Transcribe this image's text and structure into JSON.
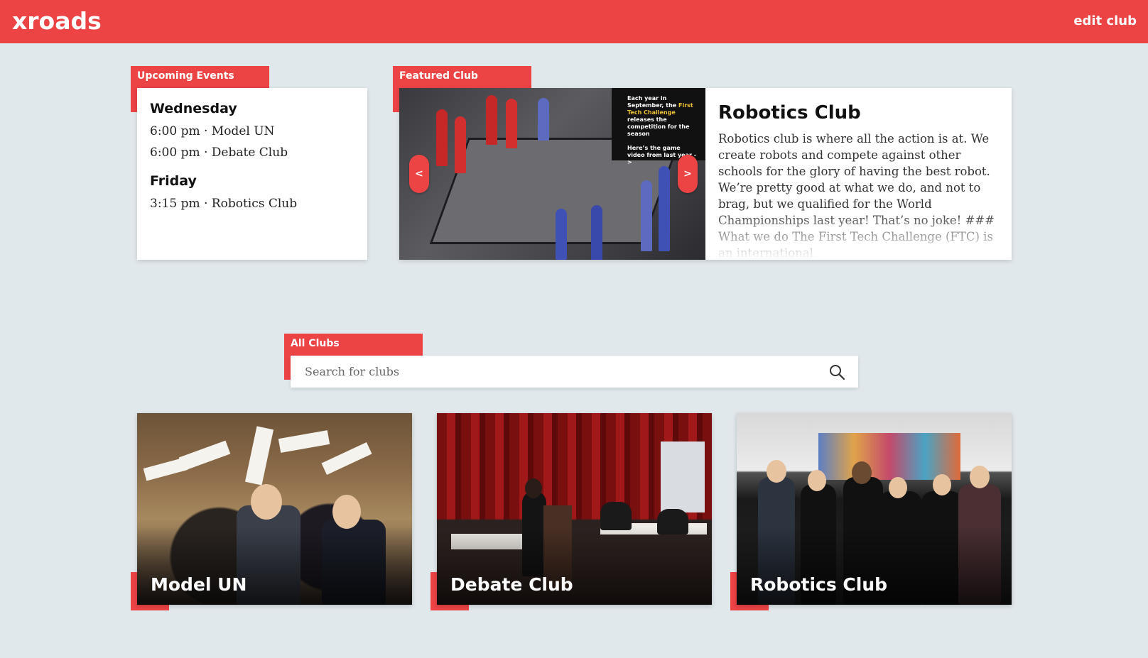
{
  "header": {
    "logo": "xroads",
    "edit_label": "edit club"
  },
  "colors": {
    "accent": "#ec4345",
    "background": "#e1e8ec"
  },
  "upcoming": {
    "tag": "Upcoming Events",
    "days": [
      {
        "day": "Wednesday",
        "events": [
          "6:00 pm · Model UN",
          "6:00 pm · Debate Club"
        ]
      },
      {
        "day": "Friday",
        "events": [
          "3:15 pm · Robotics Club"
        ]
      }
    ]
  },
  "featured": {
    "tag": "Featured Club",
    "title": "Robotics Club",
    "description": "Robotics club is where all the action is at. We create robots and compete against other schools for the glory of having the best robot. We’re pretty good at what we do, and not to brag, but we qualified for the World Championships last year! That’s no joke! ### What we do The First Tech Challenge (FTC) is an international",
    "image_caption_1": "Each year in September, the",
    "image_caption_hl": "First Tech Challenge",
    "image_caption_2": "releases the competition for the season",
    "image_caption_3": "Here’s the game video from last year ->",
    "prev_icon": "chevron-left-icon",
    "next_icon": "chevron-right-icon",
    "prev_glyph": "<",
    "next_glyph": ">"
  },
  "all_clubs": {
    "tag": "All Clubs",
    "search_placeholder": "Search for clubs",
    "search_icon": "search-icon",
    "clubs": [
      {
        "name": "Model UN"
      },
      {
        "name": "Debate Club"
      },
      {
        "name": "Robotics Club"
      }
    ]
  }
}
